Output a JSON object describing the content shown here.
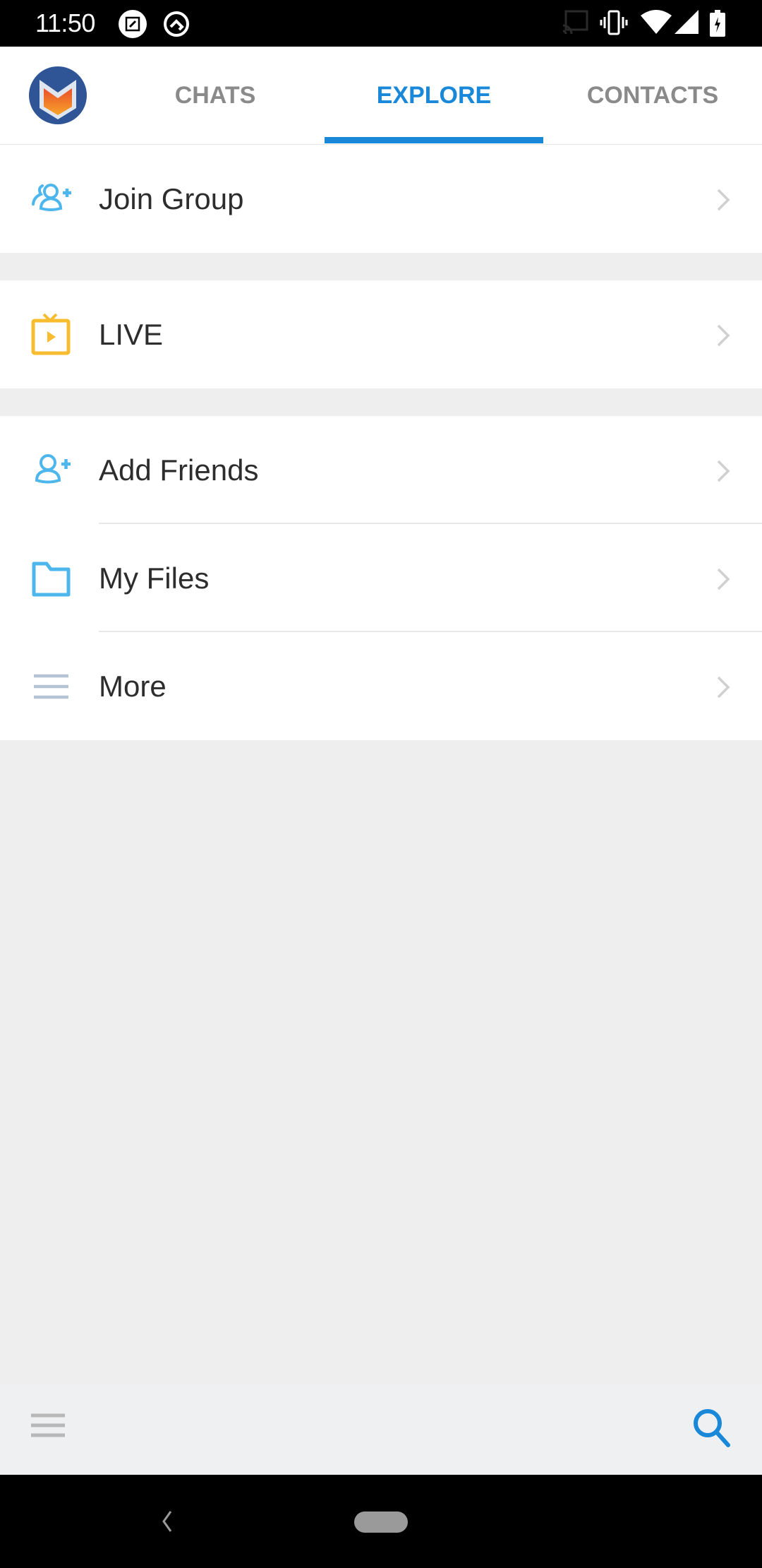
{
  "status_bar": {
    "time": "11:50",
    "left_icons": [
      "screenshot-edit-icon",
      "vpn-key-icon"
    ],
    "right_icons": [
      "cast-icon",
      "vibrate-icon",
      "wifi-icon",
      "cellular-signal-icon",
      "battery-charging-icon"
    ]
  },
  "header": {
    "logo": "app-logo",
    "tabs": [
      {
        "label": "CHATS",
        "active": false
      },
      {
        "label": "EXPLORE",
        "active": true
      },
      {
        "label": "CONTACTS",
        "active": false
      }
    ]
  },
  "explore": {
    "sections": [
      {
        "items": [
          {
            "label": "Join Group",
            "icon": "join-group-icon"
          }
        ]
      },
      {
        "items": [
          {
            "label": "LIVE",
            "icon": "live-tv-icon"
          }
        ]
      },
      {
        "items": [
          {
            "label": "Add Friends",
            "icon": "add-friend-icon"
          },
          {
            "label": "My Files",
            "icon": "folder-icon"
          },
          {
            "label": "More",
            "icon": "more-lines-icon"
          }
        ]
      }
    ]
  },
  "bottom_bar": {
    "left_icon": "hamburger-menu-icon",
    "right_icon": "search-icon"
  },
  "colors": {
    "accent": "#1a88d8",
    "icon_blue": "#4db6ec",
    "icon_yellow": "#f7bd2f",
    "inactive_tab": "#8a8a8a",
    "text": "#2d2d2d",
    "background": "#eeeeef"
  }
}
